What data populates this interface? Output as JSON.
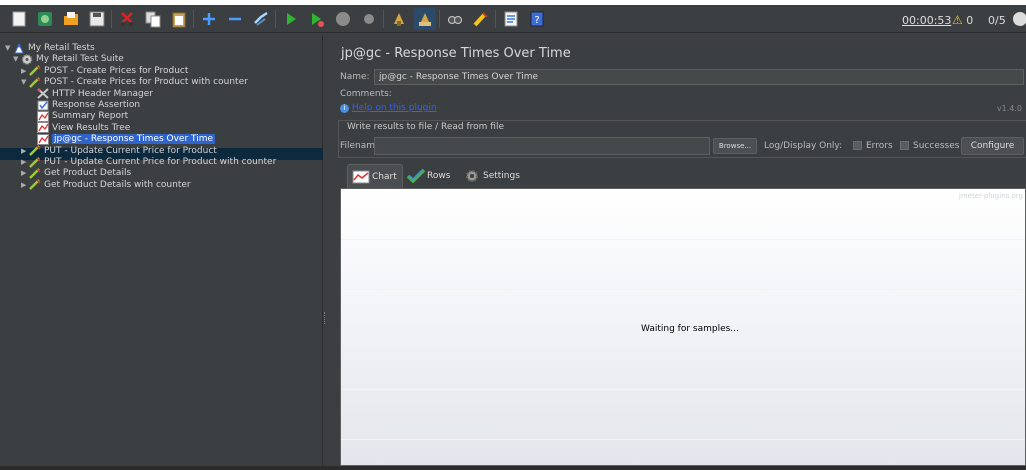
{
  "toolbar": {
    "buttons": [
      "new-icon",
      "templates-icon",
      "open-icon",
      "save-icon",
      "cut-icon",
      "copy-icon",
      "paste-icon",
      "expand-icon",
      "collapse-icon",
      "toggle-icon",
      "start-icon",
      "start-no-pauses-icon",
      "stop-icon",
      "shutdown-icon",
      "clear-icon",
      "clear-all-icon",
      "search-icon",
      "reset-search-icon",
      "function-helper-icon",
      "help-icon"
    ],
    "timer": "00:00:53",
    "warning_count": "0",
    "threads": "0/5"
  },
  "tree": {
    "items": [
      {
        "label": "My Retail Tests",
        "level": 0,
        "expanded": true,
        "icon": "test-plan-icon"
      },
      {
        "label": "My Retail Test Suite",
        "level": 1,
        "expanded": true,
        "icon": "thread-group-icon"
      },
      {
        "label": "POST - Create Prices for Product",
        "level": 2,
        "expanded": false,
        "icon": "sampler-icon"
      },
      {
        "label": "POST - Create Prices for Product with counter",
        "level": 2,
        "expanded": true,
        "icon": "sampler-icon"
      },
      {
        "label": "HTTP Header Manager",
        "level": 3,
        "icon": "config-icon"
      },
      {
        "label": "Response Assertion",
        "level": 3,
        "icon": "assertion-icon"
      },
      {
        "label": "Summary Report",
        "level": 3,
        "icon": "listener-icon"
      },
      {
        "label": "View Results Tree",
        "level": 3,
        "icon": "listener-icon"
      },
      {
        "label": "jp@gc - Response Times Over Time",
        "level": 3,
        "icon": "listener-icon",
        "selected": true
      },
      {
        "label": "PUT - Update Current Price for Product",
        "level": 2,
        "expanded": false,
        "icon": "sampler-icon"
      },
      {
        "label": "PUT - Update Current Price for Product with counter",
        "level": 2,
        "expanded": false,
        "icon": "sampler-icon"
      },
      {
        "label": "Get Product Details",
        "level": 2,
        "expanded": false,
        "icon": "sampler-icon"
      },
      {
        "label": "Get Product Details with counter",
        "level": 2,
        "expanded": false,
        "icon": "sampler-icon"
      }
    ]
  },
  "panel": {
    "title": "jp@gc - Response Times Over Time",
    "name_label": "Name:",
    "name_value": "jp@gc - Response Times Over Time",
    "comments_label": "Comments:",
    "help_link": "Help on this plugin",
    "version": "v1.4.0",
    "file_section_title": "Write results to file / Read from file",
    "filename_label": "Filename",
    "filename_value": "",
    "browse_label": "Browse...",
    "log_display_label": "Log/Display Only:",
    "errors_label": "Errors",
    "successes_label": "Successes",
    "configure_label": "Configure",
    "tabs": [
      {
        "label": "Chart",
        "active": true
      },
      {
        "label": "Rows",
        "active": false
      },
      {
        "label": "Settings",
        "active": false
      }
    ],
    "watermark": "jmeter-plugins.org",
    "waiting_text": "Waiting for samples..."
  }
}
